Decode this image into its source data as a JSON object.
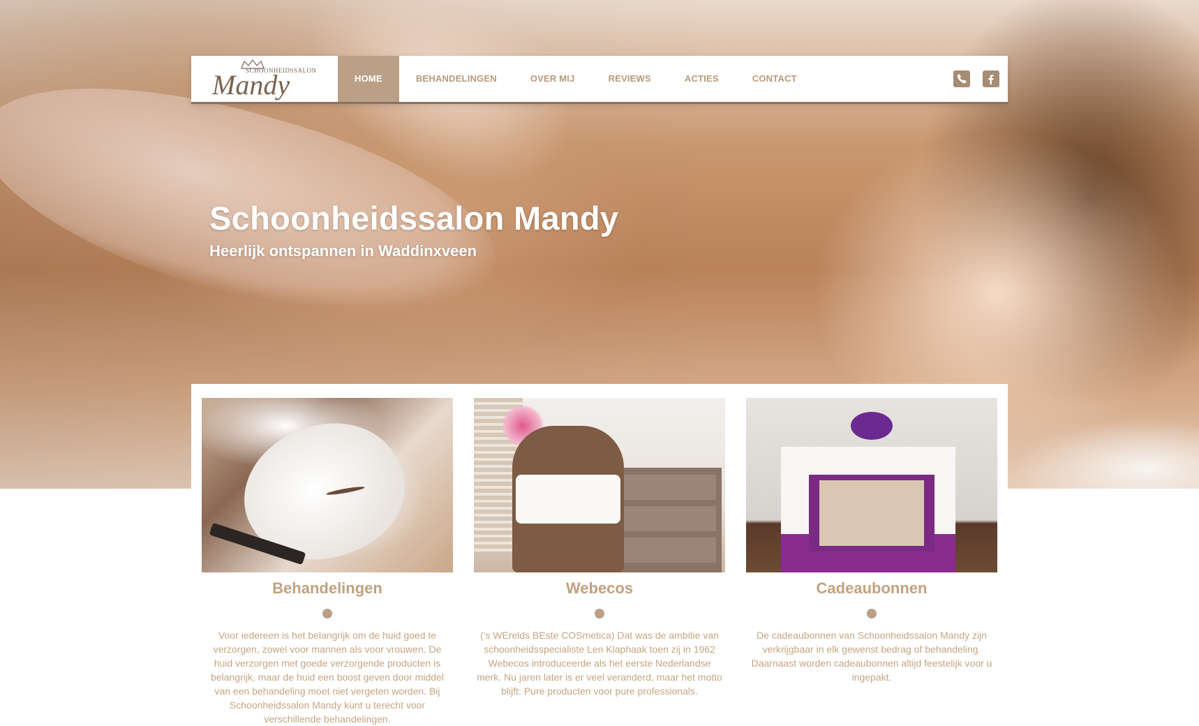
{
  "nav": {
    "logo": {
      "small_text": "SCHOONHEIDSSALON",
      "main_text": "Mandy"
    },
    "items": [
      {
        "label": "HOME",
        "active": true
      },
      {
        "label": "BEHANDELINGEN",
        "active": false
      },
      {
        "label": "OVER MIJ",
        "active": false
      },
      {
        "label": "REVIEWS",
        "active": false
      },
      {
        "label": "ACTIES",
        "active": false
      },
      {
        "label": "CONTACT",
        "active": false
      }
    ],
    "icons": [
      "phone-icon",
      "facebook-icon"
    ]
  },
  "hero": {
    "title": "Schoonheidssalon Mandy",
    "subtitle": "Heerlijk ontspannen in Waddinxveen"
  },
  "cards": [
    {
      "title": "Behandelingen",
      "text": "Voor iedereen is het belangrijk om de huid goed te verzorgen, zowel voor mannen als voor vrouwen. De huid verzorgen met goede verzorgende producten is belangrijk, maar de huid een boost geven door middel van een behandeling moet niet vergeten worden. Bij Schoonheidssalon Mandy kunt u terecht voor verschillende behandelingen."
    },
    {
      "title": "Webecos",
      "text": "('s WErelds BEste COSmetica) Dat was de ambitie van schoonheidsspecialiste Len Klaphaak toen zij in 1962 Webecos introduceerde als het eerste Nederlandse merk. Nu jaren later is er veel veranderd, maar het motto blijft: Pure producten voor pure professionals."
    },
    {
      "title": "Cadeaubonnen",
      "text": "De cadeaubonnen van Schoonheidssalon Mandy zijn verkrijgbaar in elk gewenst bedrag of behandeling. Daarnaast worden cadeaubonnen altijd feestelijk voor u ingepakt."
    }
  ],
  "colors": {
    "accent": "#b9a086",
    "nav_text": "#b89a78",
    "card_title": "#c2a17e",
    "card_text": "#c5a582",
    "nav_border": "#8a7261"
  }
}
